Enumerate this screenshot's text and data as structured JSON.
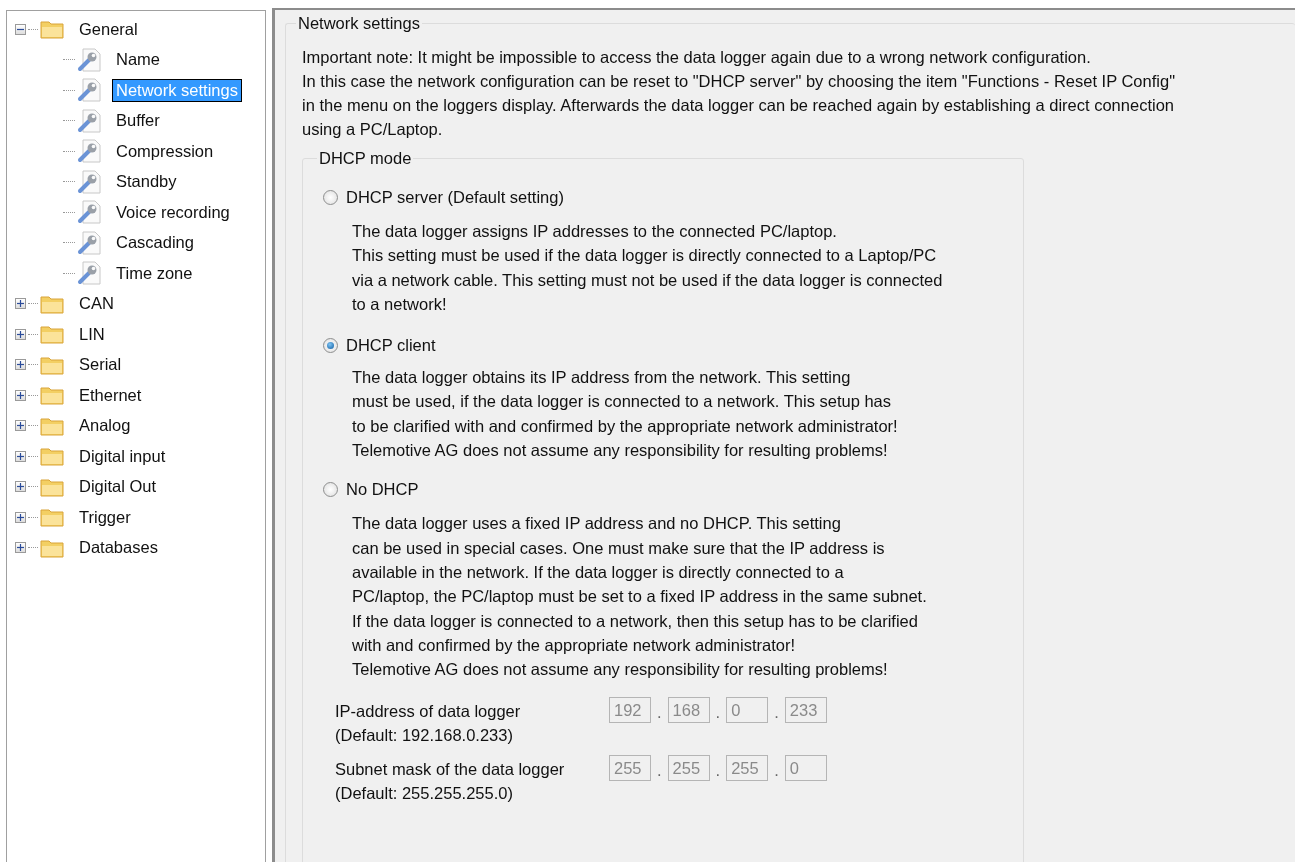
{
  "tree": [
    {
      "label": "General",
      "expanded": true,
      "selected": false,
      "children": [
        {
          "label": "Name",
          "selected": false
        },
        {
          "label": "Network settings",
          "selected": true
        },
        {
          "label": "Buffer",
          "selected": false
        },
        {
          "label": "Compression",
          "selected": false
        },
        {
          "label": "Standby",
          "selected": false
        },
        {
          "label": "Voice recording",
          "selected": false
        },
        {
          "label": "Cascading",
          "selected": false
        },
        {
          "label": "Time zone",
          "selected": false
        }
      ]
    },
    {
      "label": "CAN",
      "expanded": false,
      "selected": false
    },
    {
      "label": "LIN",
      "expanded": false,
      "selected": false
    },
    {
      "label": "Serial",
      "expanded": false,
      "selected": false
    },
    {
      "label": "Ethernet",
      "expanded": false,
      "selected": false
    },
    {
      "label": "Analog",
      "expanded": false,
      "selected": false
    },
    {
      "label": "Digital input",
      "expanded": false,
      "selected": false
    },
    {
      "label": "Digital Out",
      "expanded": false,
      "selected": false
    },
    {
      "label": "Trigger",
      "expanded": false,
      "selected": false
    },
    {
      "label": "Databases",
      "expanded": false,
      "selected": false
    }
  ],
  "settings": {
    "title": "Network settings",
    "note": "Important note: It might be impossible to access the data logger again due to a wrong network configuration.\nIn this case the network configuration can be reset to \"DHCP server\" by choosing the item \"Functions - Reset IP Config\"\nin the menu on the loggers display. Afterwards the data logger can be reached again by establishing a direct connection\nusing a PC/Laptop.",
    "dhcp_mode": {
      "title": "DHCP mode",
      "options": [
        {
          "label": "DHCP server (Default setting)",
          "selected": false,
          "description": "The data logger assigns IP addresses to the connected PC/laptop.\nThis setting must be used if the data logger is directly connected to a Laptop/PC\nvia a network cable. This setting must not be used if the data logger is connected\nto a network!"
        },
        {
          "label": "DHCP client",
          "selected": true,
          "description": "The data logger obtains its IP address from the network. This setting\nmust be used, if the data logger is connected to a network. This setup has\nto be clarified with and confirmed by the appropriate network administrator!\nTelemotive AG does not assume any responsibility for resulting problems!"
        },
        {
          "label": "No DHCP",
          "selected": false,
          "description": "The data logger uses a fixed IP address and no DHCP. This setting\ncan be used in special cases. One must make sure that the IP address is\navailable in the network. If the data logger is directly connected to a\nPC/laptop, the PC/laptop must be set to a fixed IP address in the same subnet.\nIf the data logger is connected to a network, then this setup has to be clarified\nwith and confirmed by the appropriate network administrator!\nTelemotive AG does not assume any responsibility for resulting problems!"
        }
      ],
      "addresses": [
        {
          "label": "IP-address of data logger",
          "default": "(Default: 192.168.0.233)",
          "disabled": true,
          "octets": [
            "192",
            "168",
            "0",
            "233"
          ],
          "separators": [
            ".",
            ".",
            "."
          ]
        },
        {
          "label": "Subnet mask of the data logger",
          "default": "(Default: 255.255.255.0)",
          "disabled": true,
          "octets": [
            "255",
            "255",
            "255",
            "0"
          ],
          "separators": [
            ".",
            ".",
            "."
          ]
        }
      ]
    }
  }
}
